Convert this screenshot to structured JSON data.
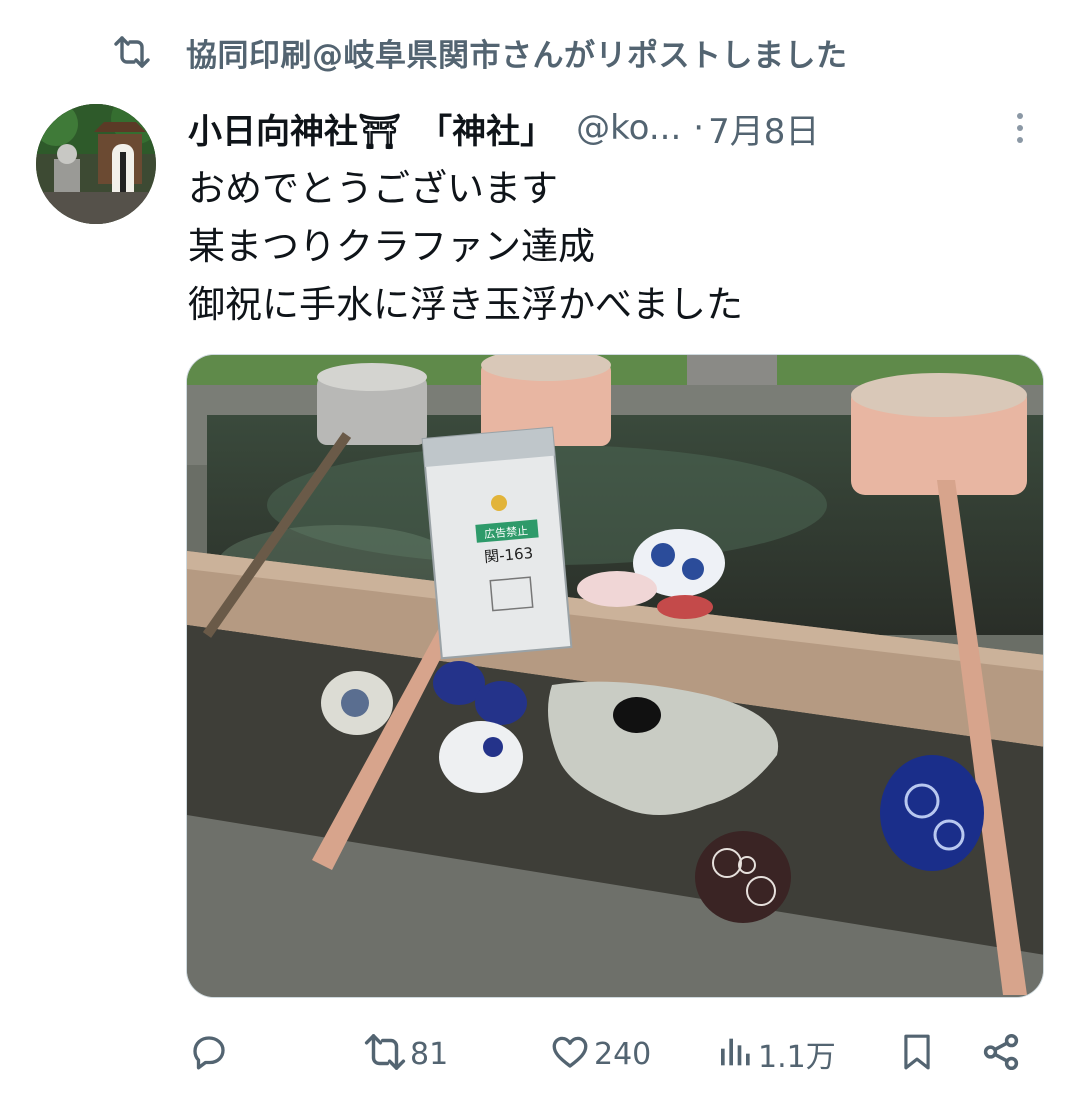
{
  "repost": {
    "icon": "repost-icon",
    "text": "協同印刷@岐阜県関市さんがリポストしました"
  },
  "post": {
    "avatar": "shrine-lantern-avatar",
    "display_name": "小日向神社⛩　「神社」",
    "handle": "@ko...",
    "separator": "·",
    "date": "7月8日",
    "more_icon": "more-vertical-icon",
    "lines": [
      "おめでとうございます",
      "某まつりクラファン達成",
      "御祝に手水に浮き玉浮かべました"
    ],
    "image_label_1": "広告禁止",
    "image_label_2": "関-163"
  },
  "actions": {
    "reply": {
      "icon": "reply-icon",
      "count": ""
    },
    "repost": {
      "icon": "repost-icon",
      "count": "81"
    },
    "like": {
      "icon": "heart-icon",
      "count": "240"
    },
    "views": {
      "icon": "views-icon",
      "count": "1.1万"
    },
    "bookmark": {
      "icon": "bookmark-icon"
    },
    "share": {
      "icon": "share-icon"
    }
  },
  "colors": {
    "secondary_text": "#536471",
    "primary_text": "#0f1419",
    "border": "#cfd9de"
  }
}
